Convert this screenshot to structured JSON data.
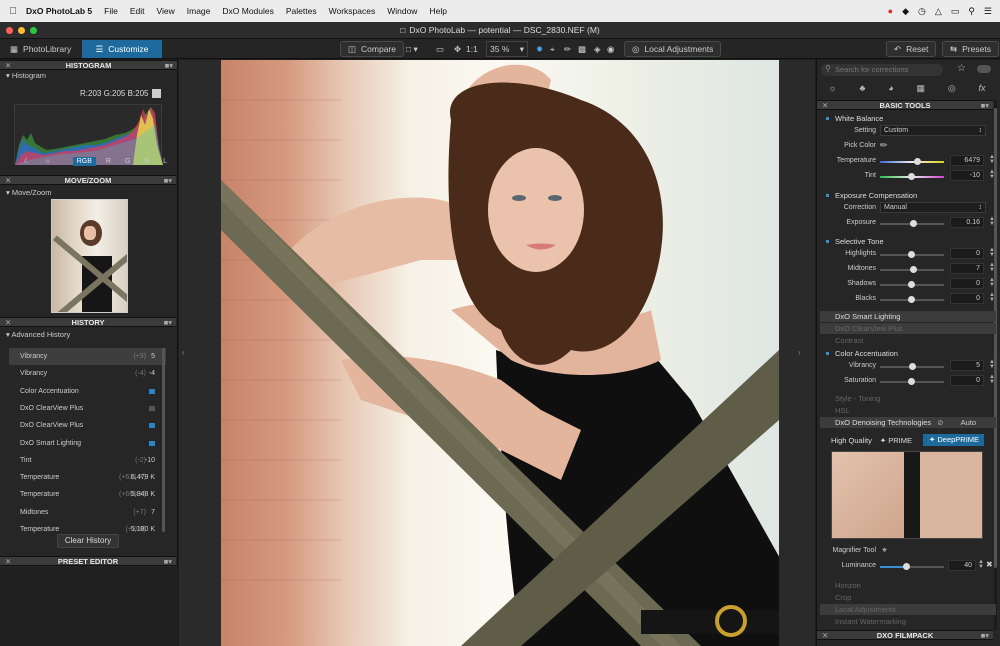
{
  "menubar": {
    "app": "DxO PhotoLab 5",
    "items": [
      "File",
      "Edit",
      "View",
      "Image",
      "DxO Modules",
      "Palettes",
      "Workspaces",
      "Window",
      "Help"
    ]
  },
  "window": {
    "title": "DxO PhotoLab — potential — DSC_2830.NEF (M)"
  },
  "toolbar": {
    "photolibrary": "PhotoLibrary",
    "customize": "Customize",
    "compare": "Compare",
    "zoom_fit": "1:1",
    "zoom": "35 %",
    "local_adjustments": "Local Adjustments",
    "reset": "Reset",
    "presets": "Presets"
  },
  "left": {
    "histogram_title": "HISTOGRAM",
    "histogram_label": "Histogram",
    "rgb_readout": "R:203 G:205 B:205",
    "channels": [
      "RGB",
      "R",
      "G",
      "B",
      "L"
    ],
    "movezoom_title": "MOVE/ZOOM",
    "movezoom_label": "Move/Zoom",
    "history_title": "HISTORY",
    "advanced_history": "Advanced History",
    "history": [
      {
        "name": "Vibrancy",
        "delta": "(+9)",
        "value": "5"
      },
      {
        "name": "Vibrancy",
        "delta": "(-4)",
        "value": "-4"
      },
      {
        "name": "Color Accentuation",
        "delta": "",
        "value": ""
      },
      {
        "name": "DxO ClearView Plus",
        "delta": "",
        "value": ""
      },
      {
        "name": "DxO ClearView Plus",
        "delta": "",
        "value": ""
      },
      {
        "name": "DxO Smart Lighting",
        "delta": "",
        "value": ""
      },
      {
        "name": "Tint",
        "delta": "(-2)",
        "value": "-10"
      },
      {
        "name": "Temperature",
        "delta": "(+631 K)",
        "value": "6,479 K"
      },
      {
        "name": "Temperature",
        "delta": "(+668 K)",
        "value": "5,848 K"
      },
      {
        "name": "Midtones",
        "delta": "(+7)",
        "value": "7"
      },
      {
        "name": "Temperature",
        "delta": "(+200)",
        "value": "5,180 K"
      }
    ],
    "clear_history": "Clear History",
    "preset_editor": "PRESET EDITOR"
  },
  "right": {
    "search_placeholder": "Search for corrections",
    "basic_tools": "BASIC TOOLS",
    "white_balance": "White Balance",
    "setting_label": "Setting",
    "setting_value": "Custom",
    "pick_color": "Pick Color",
    "temperature_label": "Temperature",
    "temperature_value": "6479",
    "tint_label": "Tint",
    "tint_value": "-10",
    "exposure_comp": "Exposure Compensation",
    "correction_label": "Correction",
    "correction_value": "Manual",
    "exposure_label": "Exposure",
    "exposure_value": "0.16",
    "selective_tone": "Selective Tone",
    "highlights_label": "Highlights",
    "highlights_value": "0",
    "midtones_label": "Midtones",
    "midtones_value": "7",
    "shadows_label": "Shadows",
    "shadows_value": "0",
    "blacks_label": "Blacks",
    "blacks_value": "0",
    "smart_lighting": "DxO Smart Lighting",
    "clearview": "DxO ClearView Plus",
    "contrast": "Contrast",
    "color_accent": "Color Accentuation",
    "vibrancy_label": "Vibrancy",
    "vibrancy_value": "5",
    "saturation_label": "Saturation",
    "saturation_value": "0",
    "style_toning": "Style - Toning",
    "hsl": "HSL",
    "denoising": "DxO Denoising Technologies",
    "auto": "Auto",
    "hq": "High Quality",
    "prime": "PRIME",
    "deepprime": "DeepPRIME",
    "magnifier": "Magnifier Tool",
    "luminance_label": "Luminance",
    "luminance_value": "40",
    "horizon": "Horizon",
    "crop": "Crop",
    "local_adj": "Local Adjustments",
    "watermark": "Instant Watermarking",
    "filmpack": "DXO FILMPACK"
  },
  "colors": {
    "accent": "#1e6a9c",
    "checkbox": "#2a84c8"
  }
}
